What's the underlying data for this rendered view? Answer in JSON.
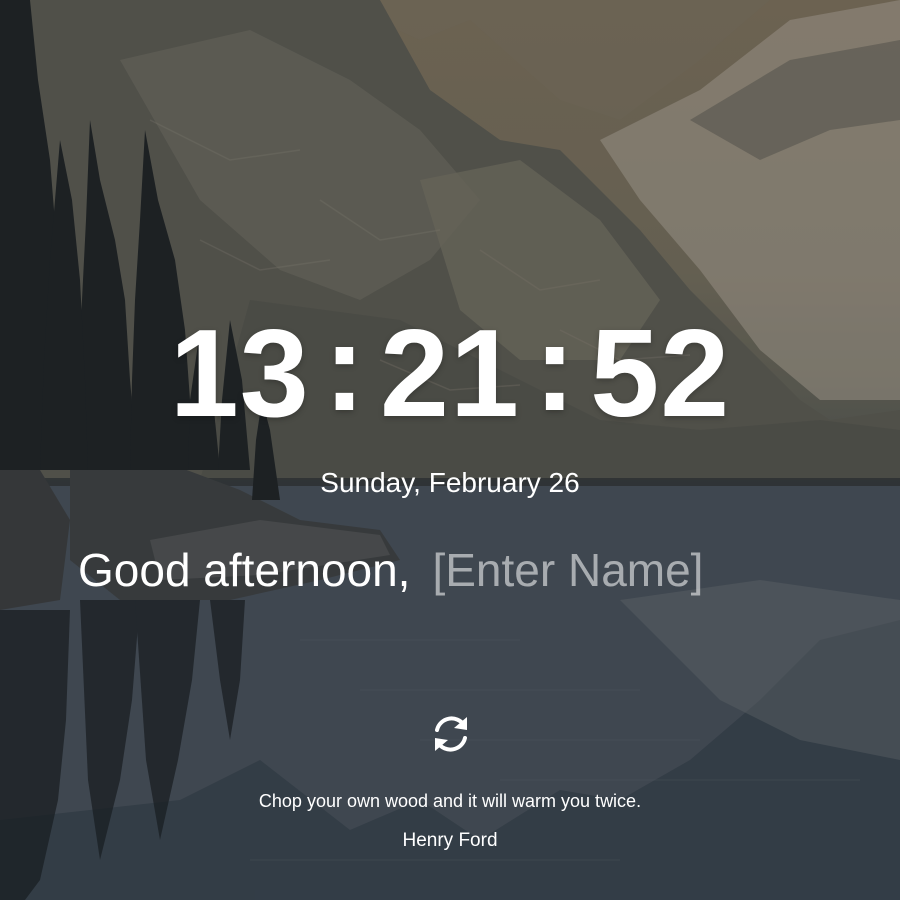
{
  "clock": {
    "hours": "13",
    "minutes": "21",
    "seconds": "52",
    "separator": ":"
  },
  "date_text": "Sunday, February 26",
  "greeting": {
    "salutation": "Good afternoon,",
    "name_placeholder": "[Enter Name]"
  },
  "refresh": {
    "icon": "refresh-icon"
  },
  "quote": {
    "text": "Chop your own wood and it will warm you twice.",
    "author": "Henry Ford"
  }
}
